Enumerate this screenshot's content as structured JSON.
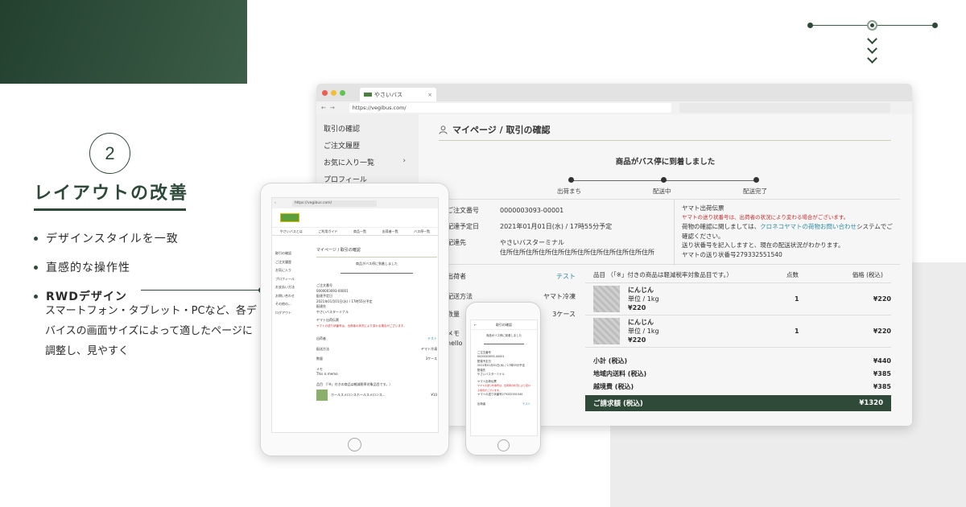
{
  "section": {
    "number": "2",
    "title": "レイアウトの改善",
    "features": [
      "デザインスタイルを一致",
      "直感的な操作性",
      "RWDデザイン"
    ],
    "rwd_description": "スマートフォン・タブレット・PCなど、各デバイスの画面サイズによって適したページに調整し、見やすく"
  },
  "colors": {
    "brand_green": "#2d4a38",
    "link": "#2d8ba6",
    "alert_red": "#cc2a2a"
  },
  "desktop": {
    "tab_title": "やさいバス",
    "url": "https://vegibus.com/",
    "sidebar": [
      {
        "label": "取引の確認",
        "chevron": false
      },
      {
        "label": "ご注文履歴",
        "chevron": false
      },
      {
        "label": "お気に入り一覧",
        "chevron": true
      },
      {
        "label": "プロフィール",
        "chevron": false
      }
    ],
    "page_title": "マイページ / 取引の確認",
    "arrived_message": "商品がバス停に到着しました",
    "progress": [
      "出荷まち",
      "配送中",
      "配送完了"
    ],
    "order_number_label": "ご注文番号",
    "order_number": "0000003093-00001",
    "delivery_date_label": "配達予定日",
    "delivery_date": "2021年01月01日(水) / 17時55分予定",
    "destination_label": "配達先",
    "destination_name": "やさいバスターミナル",
    "destination_address": "住所住所住所住所住所住所住所住所住所住所住所住所",
    "yamato_title": "ヤマト出荷伝票",
    "yamato_note": "ヤマトの送り状番号は、出荷者の状況により変わる場合がございます。",
    "yamato_text1": "荷物の確認に関しましては、",
    "yamato_link": "クロネコヤマトの荷物お問い合わせ",
    "yamato_text2": "システムでご確認ください。",
    "yamato_text3": "送り状番号を記入しますと、現在の配送状況がわかります。",
    "yamato_tracking": "ヤマトの送り状番号279332551540",
    "shipper_label": "出荷者",
    "shipper_value": "テスト",
    "method_label": "配送方法",
    "method_value": "ヤマト冷凍",
    "quantity_label": "数量",
    "quantity_value": "3ケース",
    "memo_label": "メモ",
    "memo_value": "hello",
    "items_header": {
      "item": "品目 （「※」付きの商品は軽減税率対象品目です。）",
      "qty": "点数",
      "price": "価格 (税込)"
    },
    "items": [
      {
        "name": "にんじん",
        "unit": "単位 / 1kg",
        "unit_price": "¥220",
        "qty": "1",
        "price": "¥220"
      },
      {
        "name": "にんじん",
        "unit": "単位 / 1kg",
        "unit_price": "¥220",
        "qty": "1",
        "price": "¥220"
      }
    ],
    "subtotal_label": "小計 (税込)",
    "subtotal": "¥440",
    "domestic_shipping_label": "地域内送料 (税込)",
    "domestic_shipping": "¥385",
    "cross_shipping_label": "越境費 (税込)",
    "cross_shipping": "¥385",
    "total_label": "ご請求額 (税込)",
    "total": "¥1320"
  },
  "tablet": {
    "url": "https://vegibus.com/",
    "nav": [
      "やさいバスとは",
      "ご利用ガイド",
      "商品一覧",
      "出荷者一覧",
      "バス停一覧"
    ],
    "sidebar": [
      "取引の確認",
      "ご注文履歴",
      "お気に入り",
      "プロフィール",
      "お支払い方法",
      "お問い合わせ",
      "その他の...",
      "ログアウト"
    ],
    "page_title": "マイページ / 取引の確認",
    "arrived_message": "商品がバス停に到着しました",
    "memo_text": "This is memo",
    "item_line": "ホールスメロンスホールスメロンス...",
    "item_price": "¥10"
  },
  "phone": {
    "title": "取引の確認",
    "arrived_message": "商品がバス停に到着しました"
  }
}
